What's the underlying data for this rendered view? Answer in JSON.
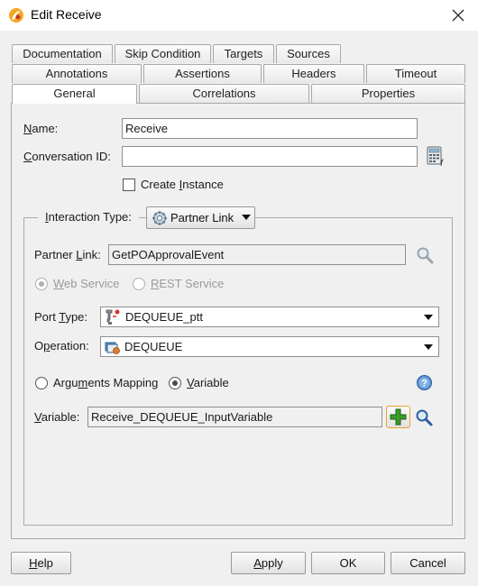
{
  "window": {
    "title": "Edit Receive"
  },
  "tabs": {
    "row1": [
      "Documentation",
      "Skip Condition",
      "Targets",
      "Sources"
    ],
    "row2": [
      "Annotations",
      "Assertions",
      "Headers",
      "Timeout"
    ],
    "row3": [
      "General",
      "Correlations",
      "Properties"
    ],
    "active": "General"
  },
  "general": {
    "name_label": "Name:",
    "name_value": "Receive",
    "conversation_id_label": "Conversation ID:",
    "conversation_id_value": "",
    "create_instance_label": "Create Instance",
    "create_instance_checked": false,
    "interaction_type_label": "Interaction Type:",
    "interaction_type_value": "Partner Link",
    "partner_link_label": "Partner Link:",
    "partner_link_value": "GetPOApprovalEvent",
    "web_service_label": "Web Service",
    "rest_service_label": "REST Service",
    "service_type_selected": "Web Service",
    "port_type_label": "Port Type:",
    "port_type_value": "DEQUEUE_ptt",
    "operation_label": "Operation:",
    "operation_value": "DEQUEUE",
    "arguments_mapping_label": "Arguments Mapping",
    "variable_option_label": "Variable",
    "mapping_selected": "Variable",
    "variable_label": "Variable:",
    "variable_value": "Receive_DEQUEUE_InputVariable"
  },
  "footer": {
    "help_label": "Help",
    "apply_label": "Apply",
    "ok_label": "OK",
    "cancel_label": "Cancel"
  },
  "icons": {
    "app": "oracle-jdev-icon",
    "close": "close-icon",
    "conversation_browse": "calculator-icon",
    "interaction_type": "partner-link-icon",
    "partner_link_browse": "search-icon",
    "port_type": "port-type-icon",
    "operation": "operation-icon",
    "help": "help-icon",
    "variable_add": "add-icon",
    "variable_browse": "search-icon"
  },
  "colors": {
    "window_bg": "#f0f0f0",
    "titlebar_bg": "#ffffff",
    "add_green": "#3a9c2a",
    "focus_orange": "#f0a030",
    "help_blue": "#2f6fb6"
  }
}
